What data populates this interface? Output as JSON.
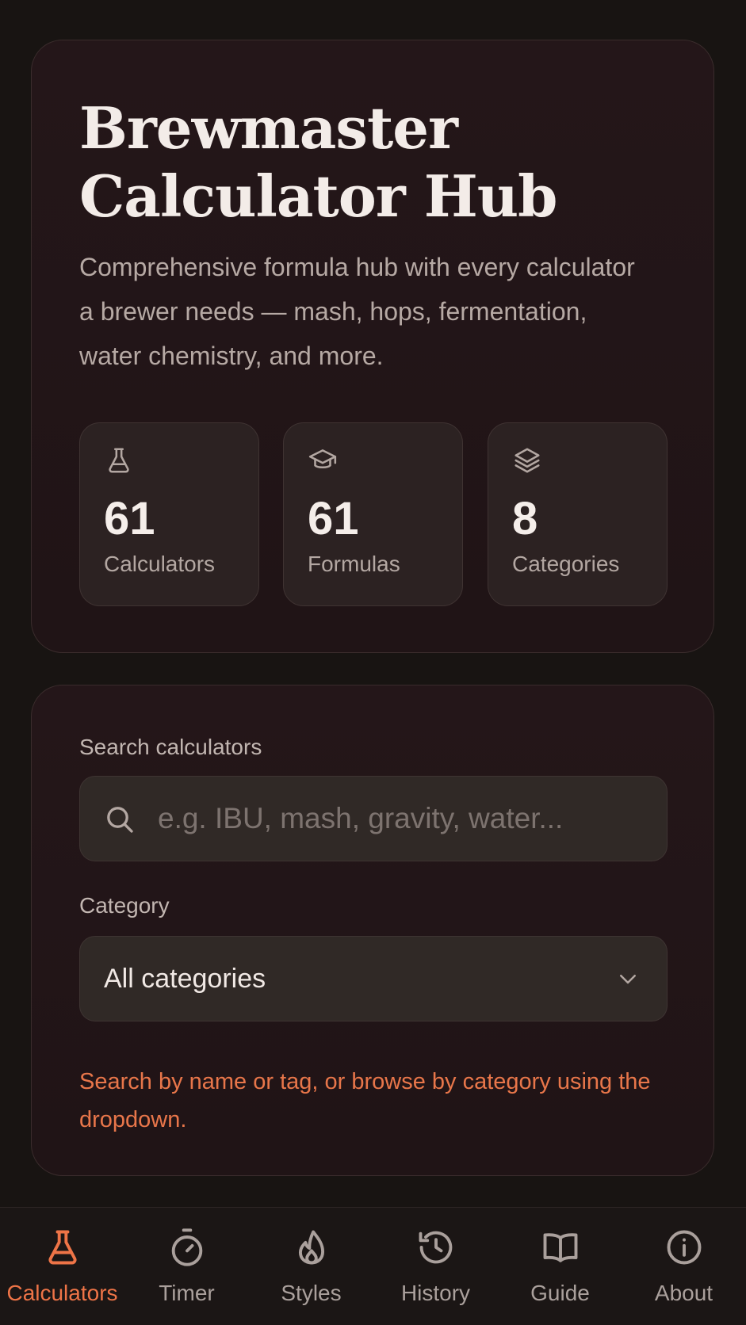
{
  "hero": {
    "title": "Brewmaster Calculator Hub",
    "subtitle": "Comprehensive formula hub with every calculator a brewer needs — mash, hops, fermentation, water chemistry, and more.",
    "stats": [
      {
        "icon": "flask-icon",
        "value": "61",
        "label": "Calculators"
      },
      {
        "icon": "graduation-cap-icon",
        "value": "61",
        "label": "Formulas"
      },
      {
        "icon": "layers-icon",
        "value": "8",
        "label": "Categories"
      }
    ]
  },
  "search": {
    "label": "Search calculators",
    "placeholder": "e.g. IBU, mash, gravity, water...",
    "value": ""
  },
  "category": {
    "label": "Category",
    "selected": "All categories"
  },
  "hint": "Search by name or tag, or browse by category using the dropdown.",
  "nav": {
    "active": "Calculators",
    "items": [
      {
        "label": "Calculators",
        "icon": "flask-icon"
      },
      {
        "label": "Timer",
        "icon": "stopwatch-icon"
      },
      {
        "label": "Styles",
        "icon": "flame-icon"
      },
      {
        "label": "History",
        "icon": "history-icon"
      },
      {
        "label": "Guide",
        "icon": "book-icon"
      },
      {
        "label": "About",
        "icon": "info-icon"
      }
    ]
  },
  "colors": {
    "accent": "#ee7447",
    "background": "#181412",
    "card": "#221518"
  }
}
